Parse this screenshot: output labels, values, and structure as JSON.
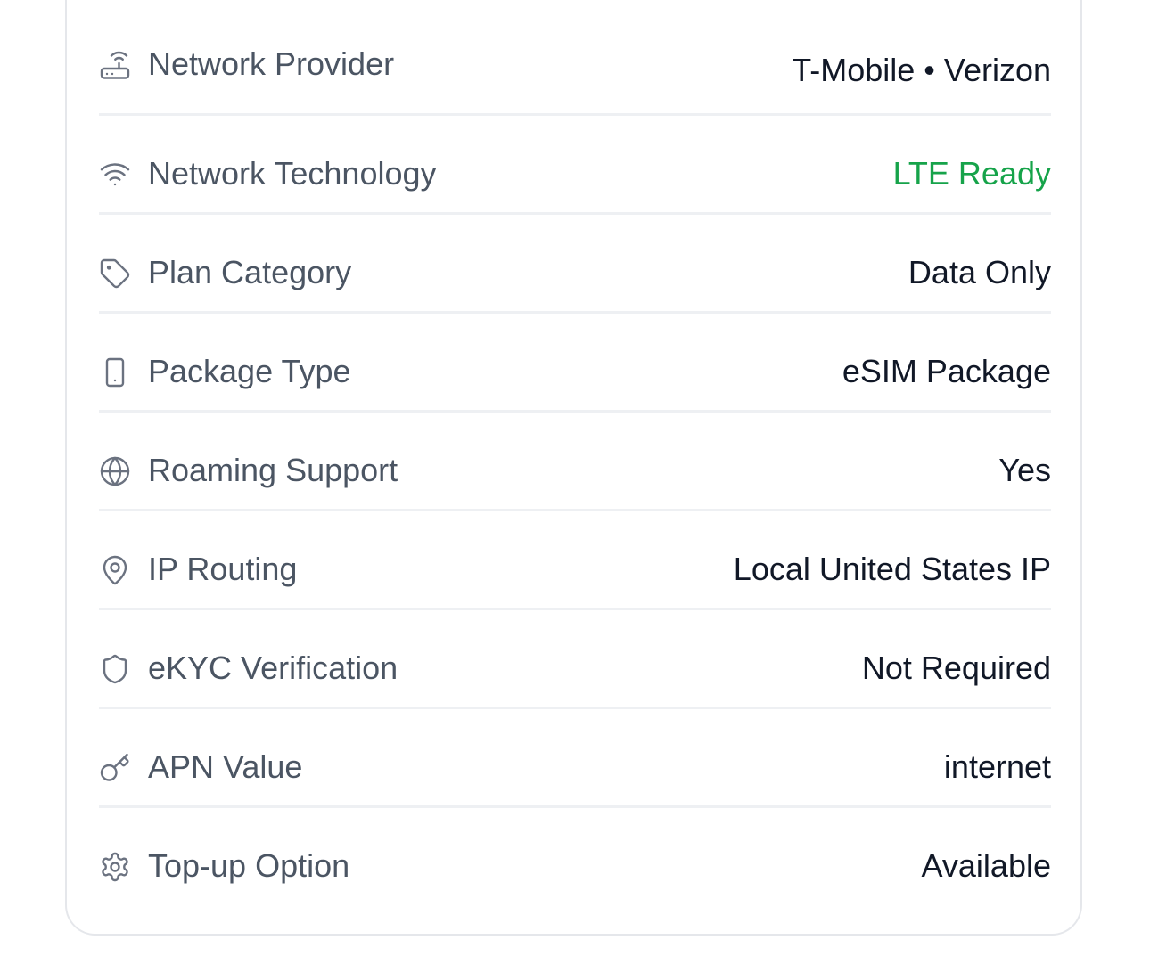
{
  "details": {
    "rows": [
      {
        "icon": "router-icon",
        "label": "Network Provider",
        "value": "T-Mobile • Verizon"
      },
      {
        "icon": "wifi-icon",
        "label": "Network Technology",
        "value": "LTE Ready",
        "value_color": "#16a34a"
      },
      {
        "icon": "tag-icon",
        "label": "Plan Category",
        "value": "Data Only"
      },
      {
        "icon": "smartphone-icon",
        "label": "Package Type",
        "value": "eSIM Package"
      },
      {
        "icon": "globe-icon",
        "label": "Roaming Support",
        "value": "Yes"
      },
      {
        "icon": "map-pin-icon",
        "label": "IP Routing",
        "value": "Local United States IP"
      },
      {
        "icon": "shield-icon",
        "label": "eKYC Verification",
        "value": "Not Required"
      },
      {
        "icon": "key-icon",
        "label": "APN Value",
        "value": "internet"
      },
      {
        "icon": "gear-icon",
        "label": "Top-up Option",
        "value": "Available"
      }
    ]
  }
}
